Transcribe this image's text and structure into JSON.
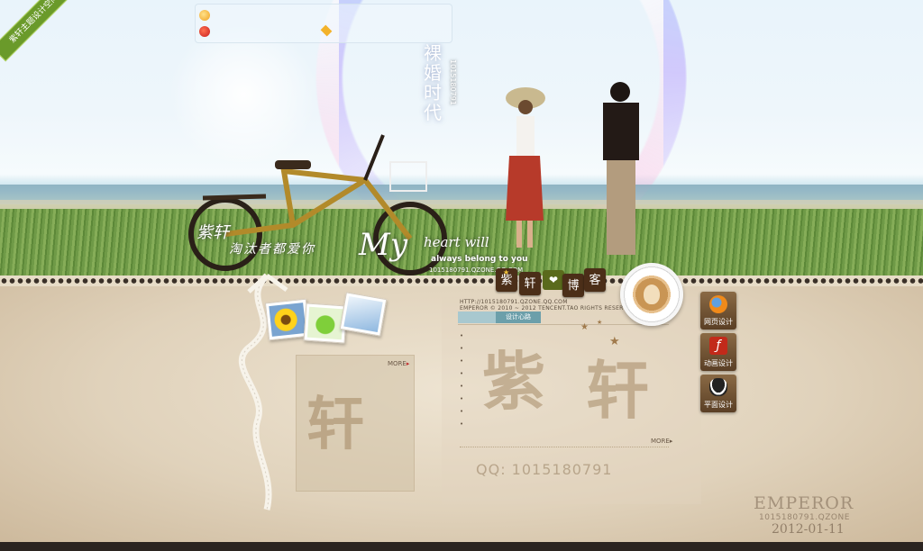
{
  "corner_ribbon": "紫轩主题设计空间",
  "hero": {
    "title_vertical": "裸婚时代",
    "qq_vertical": "1015180791",
    "calligraphy_1": "紫轩",
    "calligraphy_2": "淘汰者都爱你",
    "my_heart": "My",
    "heart_will": "heart will",
    "always": "always belong to you",
    "qq_line": "1015180791.QZONE.QQ.COM"
  },
  "blog_tiles": [
    "紫",
    "轩",
    "❤",
    "博",
    "客"
  ],
  "center": {
    "url_line_1": "HTTP://1015180791.QZONE.QQ.COM",
    "url_line_2": "EMPEROR © 2010 ~ 2012 TENCENT.TAO RIGHTS RESERVED.",
    "tab_label": "设计心路",
    "big_char_1": "紫",
    "big_char_2": "轩",
    "qq_number": "QQ: 1015180791",
    "more_label": "MORE",
    "bullets": [
      "",
      "",
      "",
      "",
      "",
      "",
      "",
      ""
    ]
  },
  "left_box": {
    "more_label": "MORE",
    "big_char": "轩"
  },
  "side_buttons": [
    {
      "label": "网页设计",
      "icon": "firefox-icon"
    },
    {
      "label": "动画设计",
      "icon": "flash-icon"
    },
    {
      "label": "平面设计",
      "icon": "qq-penguin-icon"
    }
  ],
  "signature": {
    "name": "EMPEROR",
    "sub": "1015180791.QZONE",
    "date": "2012-01-11"
  },
  "colors": {
    "tab_active": "#6c9faa",
    "tile_brown": "#4b2e18",
    "ribbon_green": "#6a9a2a"
  }
}
